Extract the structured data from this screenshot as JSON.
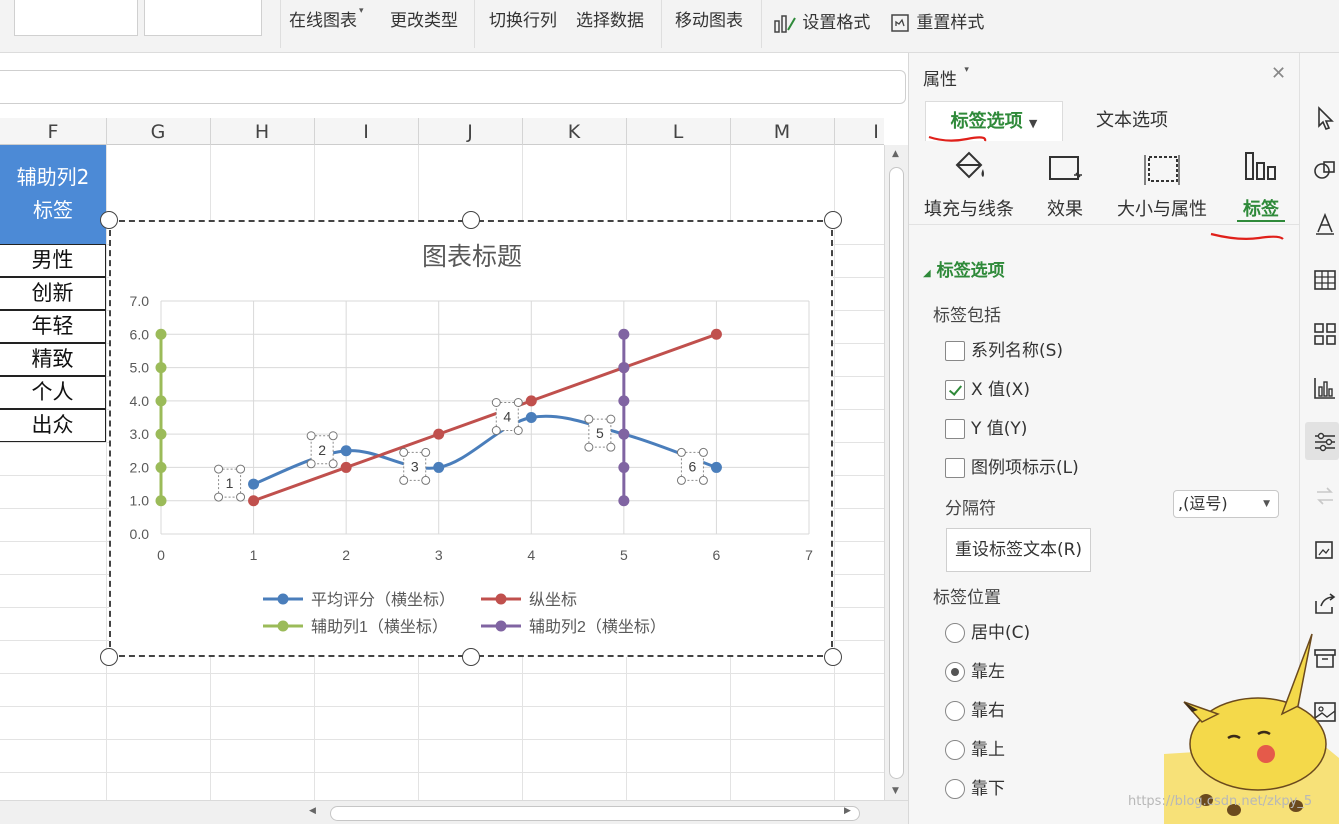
{
  "toolbar": {
    "online_chart": "在线图表",
    "change_type": "更改类型",
    "switch_row_col": "切换行列",
    "select_data": "选择数据",
    "move_chart": "移动图表",
    "set_format": "设置格式",
    "reset_style": "重置样式"
  },
  "sheet": {
    "columns": [
      "F",
      "G",
      "H",
      "I",
      "J",
      "K",
      "L",
      "M",
      "I"
    ],
    "f_header_line1": "辅助列2",
    "f_header_line2": "标签",
    "f_cells": [
      "男性",
      "创新",
      "年轻",
      "精致",
      "个人",
      "出众"
    ]
  },
  "chart_data": {
    "type": "line",
    "title": "图表标题",
    "xlim": [
      0,
      7
    ],
    "ylim": [
      0,
      7
    ],
    "x_ticks": [
      "0",
      "1",
      "2",
      "3",
      "4",
      "5",
      "6",
      "7"
    ],
    "y_ticks": [
      "0.0",
      "1.0",
      "2.0",
      "3.0",
      "4.0",
      "5.0",
      "6.0",
      "7.0"
    ],
    "grid": true,
    "legend_position": "bottom",
    "series": [
      {
        "name": "平均评分（横坐标）",
        "color": "#4a7ebb",
        "smooth": true,
        "points": [
          [
            1,
            1.5
          ],
          [
            2,
            2.5
          ],
          [
            3,
            2.0
          ],
          [
            4,
            3.5
          ],
          [
            5,
            3.0
          ],
          [
            6,
            2.0
          ]
        ]
      },
      {
        "name": "纵坐标",
        "color": "#c0504d",
        "smooth": false,
        "points": [
          [
            1,
            1.0
          ],
          [
            2,
            2.0
          ],
          [
            3,
            3.0
          ],
          [
            4,
            4.0
          ],
          [
            5,
            5.0
          ],
          [
            6,
            6.0
          ]
        ]
      },
      {
        "name": "辅助列1（横坐标）",
        "color": "#9bbb59",
        "smooth": false,
        "points": [
          [
            0,
            1.0
          ],
          [
            0,
            2.0
          ],
          [
            0,
            3.0
          ],
          [
            0,
            4.0
          ],
          [
            0,
            5.0
          ],
          [
            0,
            6.0
          ]
        ]
      },
      {
        "name": "辅助列2（横坐标）",
        "color": "#8064a2",
        "smooth": false,
        "points": [
          [
            5,
            1.0
          ],
          [
            5,
            2.0
          ],
          [
            5,
            3.0
          ],
          [
            5,
            4.0
          ],
          [
            5,
            5.0
          ],
          [
            5,
            6.0
          ]
        ]
      }
    ],
    "data_labels": [
      {
        "text": "1",
        "x": 1,
        "y": 1.5
      },
      {
        "text": "2",
        "x": 2,
        "y": 2.5
      },
      {
        "text": "3",
        "x": 3,
        "y": 2.0
      },
      {
        "text": "4",
        "x": 4,
        "y": 3.5
      },
      {
        "text": "5",
        "x": 5,
        "y": 3.0
      },
      {
        "text": "6",
        "x": 6,
        "y": 2.0
      }
    ]
  },
  "panel": {
    "title": "属性",
    "tab_label_options": "标签选项",
    "tab_text_options": "文本选项",
    "sub_fill": "填充与线条",
    "sub_effect": "效果",
    "sub_size": "大小与属性",
    "sub_label": "标签",
    "section_title": "标签选项",
    "label_contains": "标签包括",
    "chk_series_name": "系列名称(S)",
    "chk_x_value": "X 值(X)",
    "chk_y_value": "Y 值(Y)",
    "chk_legend_key": "图例项标示(L)",
    "separator_label": "分隔符",
    "separator_value": ",(逗号)",
    "reset_label_text": "重设标签文本(R)",
    "label_position": "标签位置",
    "pos_center": "居中(C)",
    "pos_left": "靠左",
    "pos_right": "靠右",
    "pos_above": "靠上",
    "pos_below": "靠下"
  },
  "colors": {
    "accent_green": "#2f8a3a",
    "header_blue": "#4c8ad6",
    "scribble_red": "#e0201a"
  },
  "watermark": "https://blog.csdn.net/zkpy_5"
}
